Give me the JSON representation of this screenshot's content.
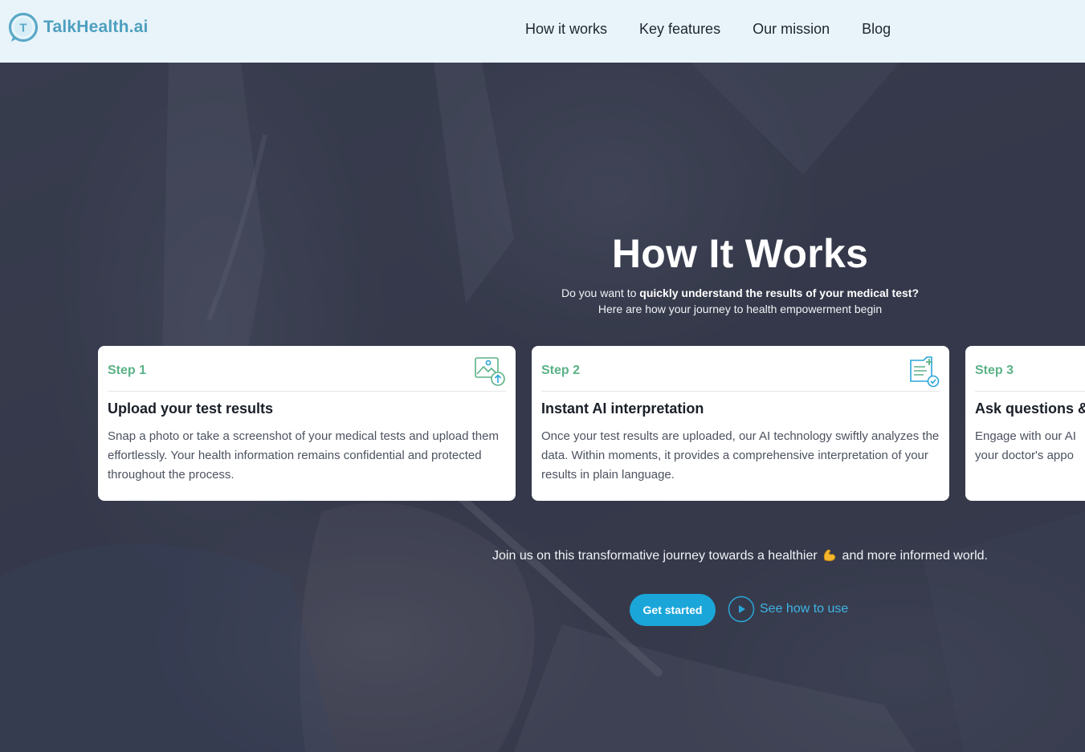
{
  "header": {
    "brand": "TalkHealth.ai",
    "logo_letter": "T",
    "nav": [
      "How it works",
      "Key features",
      "Our mission",
      "Blog"
    ]
  },
  "hero": {
    "title": "How It Works",
    "subtitle_prefix": "Do you want to ",
    "subtitle_bold": "quickly understand the results of your medical test?",
    "subtitle_line2": "Here are how your journey to health empowerment begin",
    "cards": [
      {
        "step": "Step 1",
        "icon": "image-upload-icon",
        "title": "Upload your test results",
        "text": "Snap a photo or take a screenshot of your medical tests and upload them effortlessly. Your health information remains confidential and protected throughout the process."
      },
      {
        "step": "Step 2",
        "icon": "document-check-icon",
        "title": "Instant AI interpretation",
        "text": "Once your test results are uploaded, our AI technology swiftly analyzes the data. Within moments, it provides a comprehensive interpretation of your results in plain language."
      },
      {
        "step": "Step 3",
        "title": "Ask questions &",
        "text": "Engage with our AI your doctor's appo"
      }
    ],
    "join_prefix": "Join us on this transformative journey towards a healthier ",
    "join_emoji": "flexed-biceps-emoji",
    "join_suffix": " and more informed world.",
    "cta_label": "Get started",
    "howto_label": "See how to use"
  },
  "colors": {
    "header_bg": "#e8f4fa",
    "brand": "#4e9fbf",
    "step_green": "#5bb287",
    "cta_blue": "#1ba6d9",
    "link_blue": "#3fb6e6"
  }
}
